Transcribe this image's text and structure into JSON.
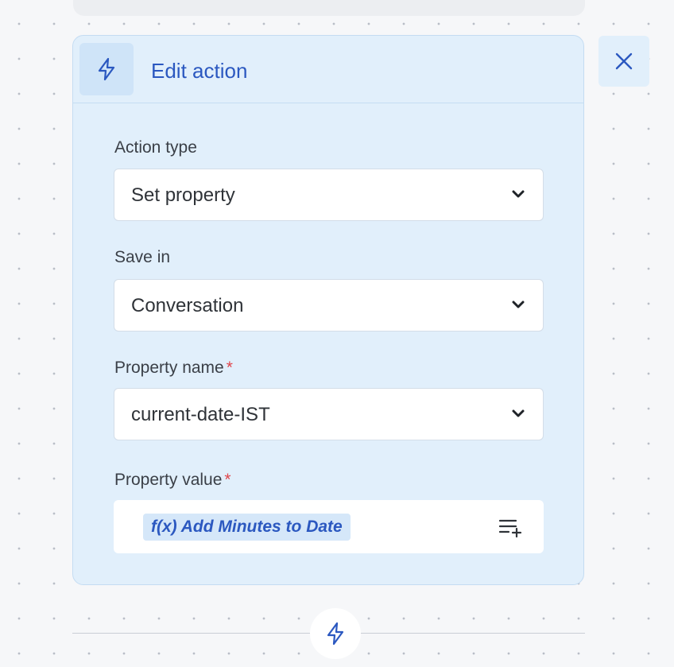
{
  "panel": {
    "title": "Edit action",
    "header_icon": "lightning-bolt-icon"
  },
  "fields": {
    "action_type": {
      "label": "Action type",
      "value": "Set property"
    },
    "save_in": {
      "label": "Save in",
      "value": "Conversation"
    },
    "property_name": {
      "label": "Property name",
      "required_mark": "*",
      "value": "current-date-IST"
    },
    "property_value": {
      "label": "Property value",
      "required_mark": "*",
      "function_chip": "f(x) Add Minutes to Date",
      "add_icon": "add-variable-icon"
    }
  },
  "controls": {
    "close_icon": "close-icon",
    "node_icon": "lightning-bolt-icon"
  },
  "colors": {
    "accent": "#2b58c0",
    "panel_background": "#e1effb",
    "required": "#e0464c"
  }
}
